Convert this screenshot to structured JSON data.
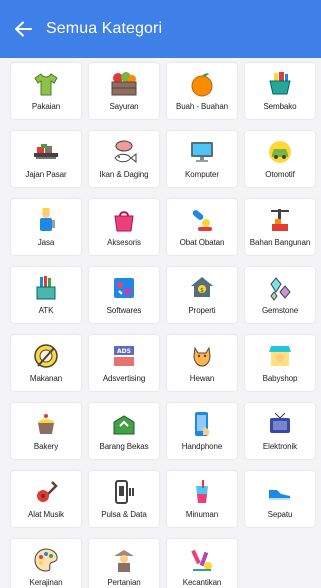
{
  "header": {
    "title": "Semua Kategori",
    "background": "#3f7fe8"
  },
  "categories": [
    {
      "label": "Pakaian",
      "icon": "shirt-icon"
    },
    {
      "label": "Sayuran",
      "icon": "vegetable-crate-icon"
    },
    {
      "label": "Buah - Buahan",
      "icon": "orange-fruit-icon"
    },
    {
      "label": "Sembako",
      "icon": "grocery-basket-icon"
    },
    {
      "label": "Jajan Pasar",
      "icon": "snack-tray-icon"
    },
    {
      "label": "Ikan & Daging",
      "icon": "fish-meat-icon"
    },
    {
      "label": "Komputer",
      "icon": "computer-monitor-icon"
    },
    {
      "label": "Otomotif",
      "icon": "car-icon"
    },
    {
      "label": "Jasa",
      "icon": "worker-icon"
    },
    {
      "label": "Aksesoris",
      "icon": "handbag-icon"
    },
    {
      "label": "Obat Obatan",
      "icon": "medicine-icon"
    },
    {
      "label": "Bahan Bangunan",
      "icon": "construction-crane-icon"
    },
    {
      "label": "ATK",
      "icon": "stationery-icon"
    },
    {
      "label": "Softwares",
      "icon": "software-icon"
    },
    {
      "label": "Properti",
      "icon": "property-house-icon"
    },
    {
      "label": "Gemstone",
      "icon": "gemstone-icon"
    },
    {
      "label": "Makanan",
      "icon": "food-plate-icon"
    },
    {
      "label": "Adsvertising",
      "icon": "ads-banner-icon"
    },
    {
      "label": "Hewan",
      "icon": "cat-icon"
    },
    {
      "label": "Babyshop",
      "icon": "baby-shop-icon"
    },
    {
      "label": "Bakery",
      "icon": "cupcake-icon"
    },
    {
      "label": "Barang Bekas",
      "icon": "recycle-box-icon"
    },
    {
      "label": "Handphone",
      "icon": "smartphone-icon"
    },
    {
      "label": "Elektronik",
      "icon": "television-icon"
    },
    {
      "label": "Alat Musik",
      "icon": "guitar-icon"
    },
    {
      "label": "Pulsa & Data",
      "icon": "phone-credit-icon"
    },
    {
      "label": "Minuman",
      "icon": "drink-icon"
    },
    {
      "label": "Sepatu",
      "icon": "shoe-icon"
    },
    {
      "label": "Kerajinan",
      "icon": "paint-palette-icon"
    },
    {
      "label": "Pertanian",
      "icon": "farmer-icon"
    },
    {
      "label": "Kecantikan",
      "icon": "cosmetics-icon"
    }
  ]
}
